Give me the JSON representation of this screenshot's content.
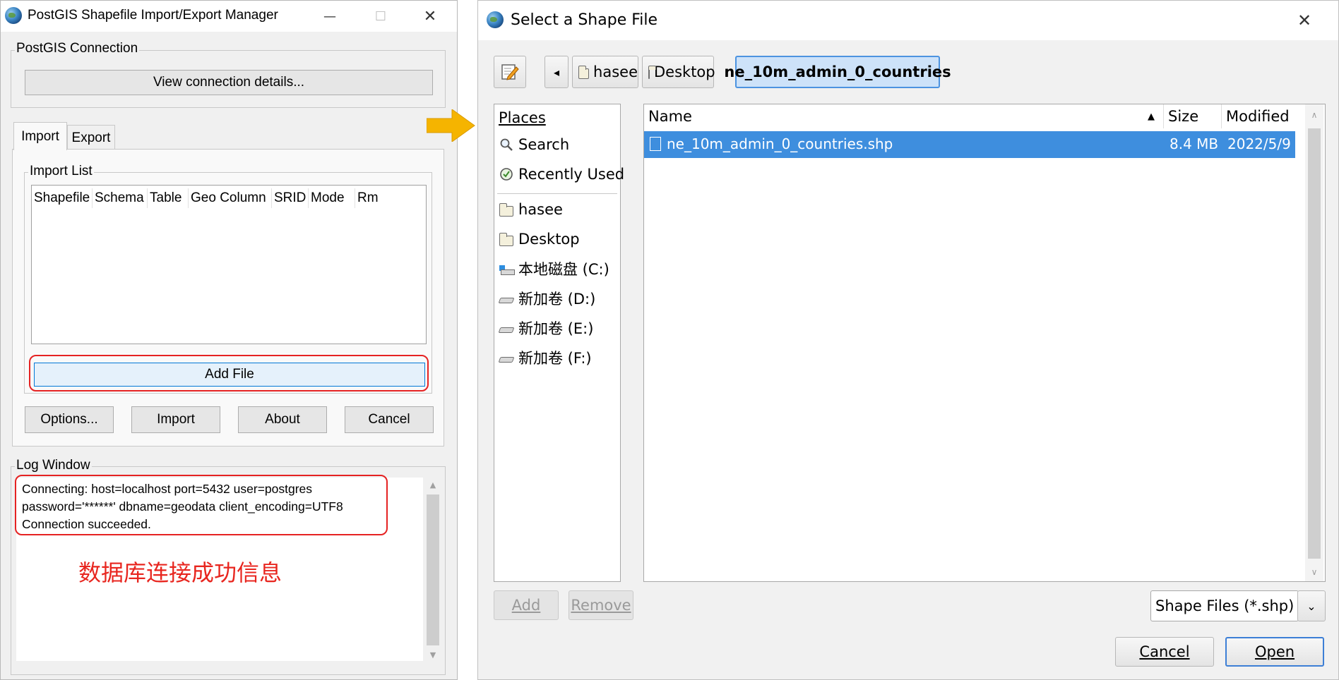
{
  "left_window": {
    "title": "PostGIS Shapefile Import/Export Manager",
    "controls": {
      "minimize": "—",
      "maximize": "☐",
      "close": "✕"
    },
    "connection": {
      "group_label": "PostGIS Connection",
      "view_button": "View connection details..."
    },
    "tabs": [
      {
        "label": "Import"
      },
      {
        "label": "Export"
      }
    ],
    "import_list": {
      "group_label": "Import List",
      "columns": [
        "Shapefile",
        "Schema",
        "Table",
        "Geo Column",
        "SRID",
        "Mode",
        "Rm"
      ],
      "add_file_button": "Add File"
    },
    "buttons": {
      "options": "Options...",
      "import": "Import",
      "about": "About",
      "cancel": "Cancel"
    },
    "log": {
      "group_label": "Log Window",
      "lines": [
        "Connecting:  host=localhost port=5432 user=postgres",
        "password='******' dbname=geodata client_encoding=UTF8",
        "Connection succeeded."
      ],
      "annotation": "数据库连接成功信息"
    }
  },
  "right_window": {
    "title": "Select a Shape File",
    "close": "✕",
    "path_bar": {
      "back": "◂",
      "crumbs": [
        "hasee",
        "Desktop",
        "ne_10m_admin_0_countries"
      ]
    },
    "places": {
      "header": "Places",
      "items": [
        {
          "label": "Search",
          "icon": "search-icon"
        },
        {
          "label": "Recently Used",
          "icon": "recent-icon"
        },
        {
          "label": "hasee",
          "icon": "folder-icon"
        },
        {
          "label": "Desktop",
          "icon": "folder-icon"
        },
        {
          "label": "本地磁盘 (C:)",
          "icon": "system-drive-icon"
        },
        {
          "label": "新加卷 (D:)",
          "icon": "drive-icon"
        },
        {
          "label": "新加卷 (E:)",
          "icon": "drive-icon"
        },
        {
          "label": "新加卷 (F:)",
          "icon": "drive-icon"
        }
      ]
    },
    "files": {
      "columns": {
        "name": "Name",
        "size": "Size",
        "modified": "Modified"
      },
      "sort_indicator": "▲",
      "rows": [
        {
          "name": "ne_10m_admin_0_countries.shp",
          "size": "8.4 MB",
          "modified": "2022/5/9"
        }
      ]
    },
    "add_button": "Add",
    "remove_button": "Remove",
    "filter": {
      "value": "Shape Files (*.shp)"
    },
    "cancel_button": "Cancel",
    "open_button": "Open"
  },
  "colors": {
    "selection": "#3e8ede",
    "highlight_outline": "#e52222",
    "annotation": "#e8261f",
    "arrow": "#f5b400"
  }
}
